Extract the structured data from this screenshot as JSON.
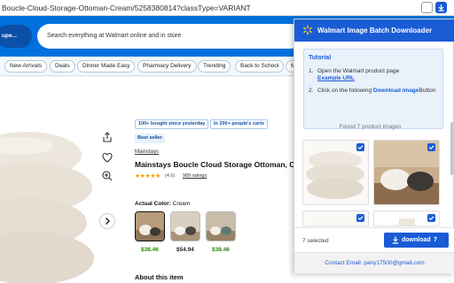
{
  "browser": {
    "url": "Boucle-Cloud-Storage-Ottoman-Cream/5258380814?classType=VARIANT"
  },
  "header": {
    "store_label": "upe...",
    "search_placeholder": "Search everything at Walmart online and in store"
  },
  "nav": {
    "chips": [
      "New Arrivals",
      "Deals",
      "Dinner Made Easy",
      "Pharmacy Delivery",
      "Trending",
      "Back to School",
      "M"
    ]
  },
  "product": {
    "badges": [
      "100+ bought since yesterday",
      "In 200+ people's carts"
    ],
    "bestseller": "Best seller",
    "brand": "Mainstays",
    "title": "Mainstays Boucle Cloud Storage Ottoman, Cream",
    "rating_stars": 4.6,
    "rating_value": "(4.6)",
    "ratings_link": "989 ratings",
    "actual_color_label": "Actual Color:",
    "actual_color_value": "Cream",
    "variant_prices": [
      "$38.46",
      "$54.94",
      "$38.46"
    ],
    "about_heading": "About this item"
  },
  "extension": {
    "title": "Walmart Image Batch Downloader",
    "tutorial_title": "Tutorial",
    "step1_text": "Open the Walmart product page",
    "step1_link": "Example URL",
    "step2_text": "Click on the following",
    "step2_strong": "Download image",
    "step2_suffix": "Button",
    "found_text": "Found 7 product images",
    "selected_text": "7 selected",
    "download_label": "download",
    "download_count": "7",
    "contact": "Contact Email: pany17500@gmail.com",
    "accent_color": "#1a5cd6"
  }
}
